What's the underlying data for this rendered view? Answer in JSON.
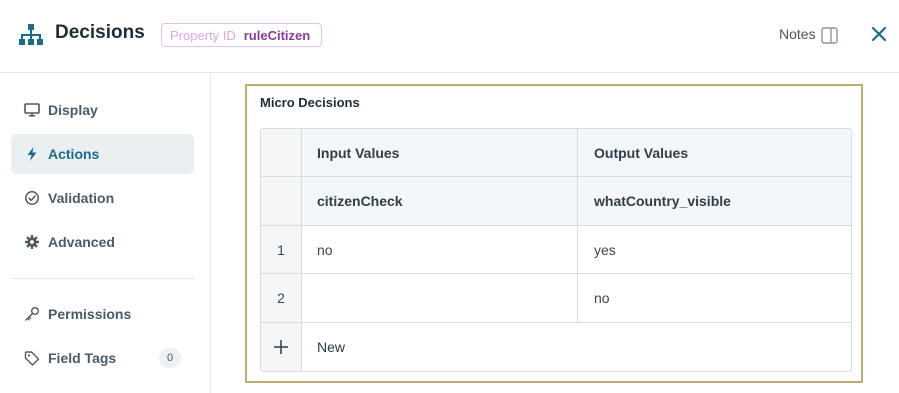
{
  "header": {
    "title": "Decisions",
    "property_label": "Property ID",
    "property_value": "ruleCitizen",
    "notes_label": "Notes",
    "icon": "sitemap-icon"
  },
  "sidebar": {
    "items": [
      {
        "label": "Display",
        "icon": "monitor-icon"
      },
      {
        "label": "Actions",
        "icon": "lightning-icon",
        "active": true
      },
      {
        "label": "Validation",
        "icon": "check-circle-icon"
      },
      {
        "label": "Advanced",
        "icon": "gear-icon"
      },
      {
        "label": "Permissions",
        "icon": "key-icon"
      },
      {
        "label": "Field Tags",
        "icon": "tag-icon",
        "count": "0"
      }
    ]
  },
  "micro_decisions": {
    "title": "Micro Decisions",
    "headers": {
      "input": "Input Values",
      "output": "Output Values"
    },
    "fields": {
      "input": "citizenCheck",
      "output": "whatCountry_visible"
    },
    "rows": [
      {
        "index": "1",
        "input": "no",
        "output": "yes"
      },
      {
        "index": "2",
        "input": "",
        "output": "no"
      }
    ],
    "add_label": "New"
  },
  "colors": {
    "accent": "#1c6b8a",
    "panel_border": "#bfae6e",
    "pill_border": "#e2c2e8"
  }
}
